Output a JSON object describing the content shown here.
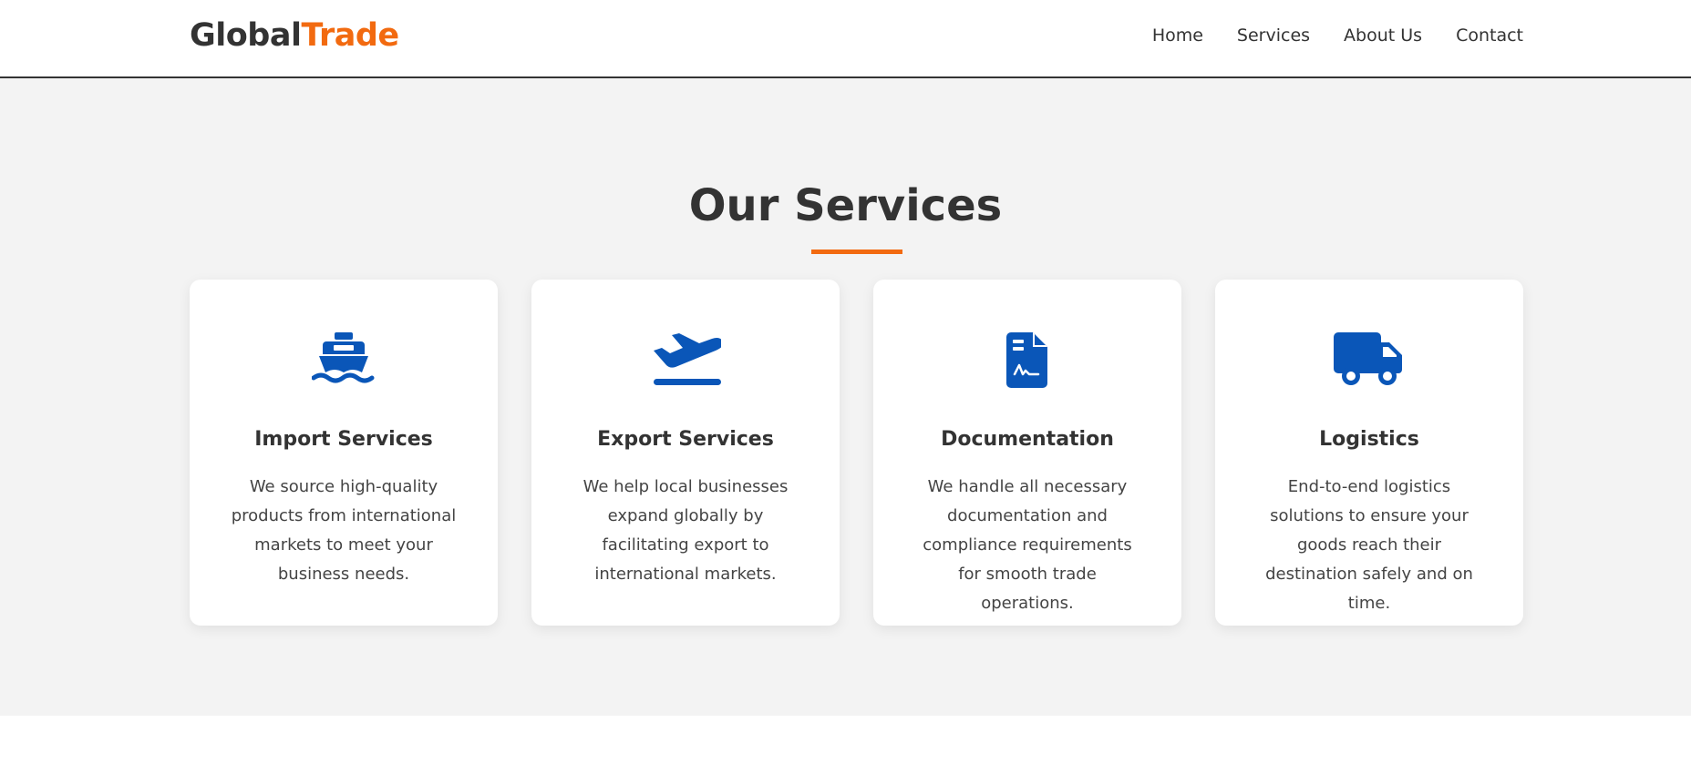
{
  "brand": {
    "name_part1": "Global",
    "name_part2": "Trade"
  },
  "nav": {
    "home": "Home",
    "services": "Services",
    "about": "About Us",
    "contact": "Contact"
  },
  "services": {
    "title": "Our Services",
    "cards": [
      {
        "icon": "ship-icon",
        "title": "Import Services",
        "text": "We source high-quality products from international markets to meet your business needs."
      },
      {
        "icon": "plane-departure-icon",
        "title": "Export Services",
        "text": "We help local businesses expand globally by facilitating export to international markets."
      },
      {
        "icon": "file-contract-icon",
        "title": "Documentation",
        "text": "We handle all necessary documentation and compliance requirements for smooth trade operations."
      },
      {
        "icon": "truck-icon",
        "title": "Logistics",
        "text": "End-to-end logistics solutions to ensure your goods reach their destination safely and on time."
      }
    ]
  },
  "colors": {
    "accent": "#f26a10",
    "icon_blue": "#0a56b8",
    "text": "#333333",
    "section_bg": "#f3f3f3"
  }
}
